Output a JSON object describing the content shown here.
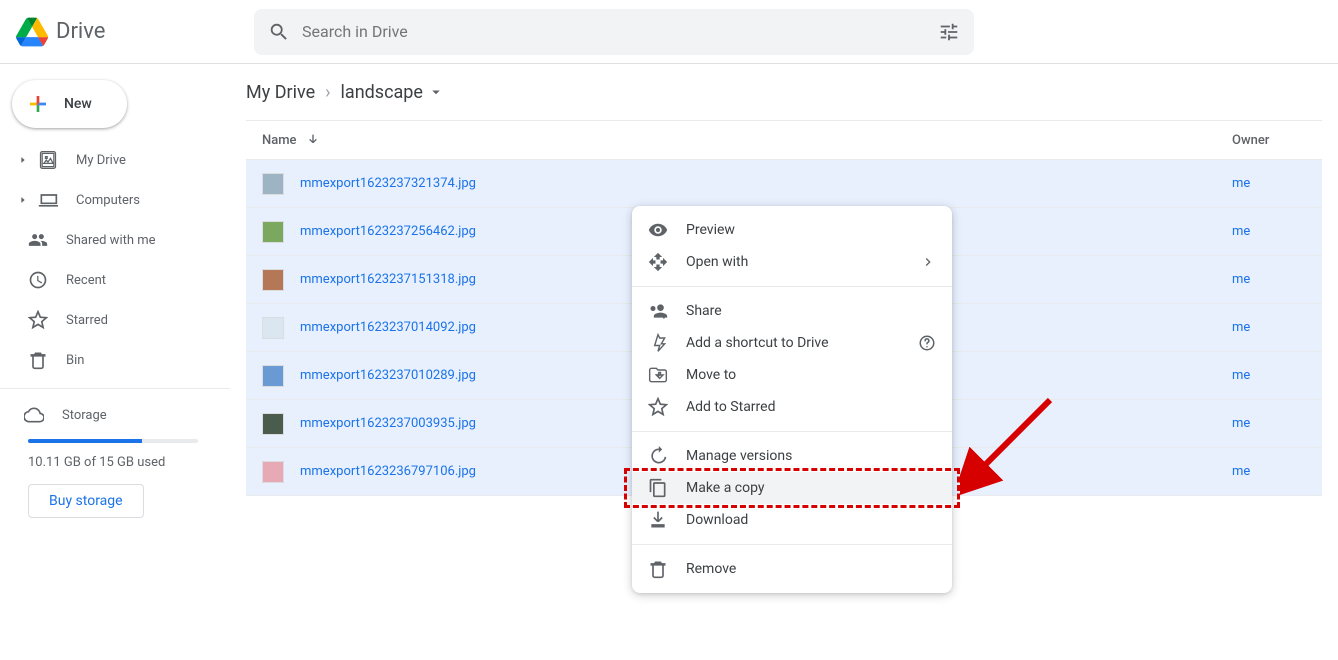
{
  "app": {
    "title": "Drive"
  },
  "search": {
    "placeholder": "Search in Drive"
  },
  "sidebar": {
    "new_label": "New",
    "items": [
      {
        "label": "My Drive"
      },
      {
        "label": "Computers"
      },
      {
        "label": "Shared with me"
      },
      {
        "label": "Recent"
      },
      {
        "label": "Starred"
      },
      {
        "label": "Bin"
      }
    ],
    "storage": {
      "label": "Storage",
      "used_text": "10.11 GB of 15 GB used",
      "buy_label": "Buy storage"
    }
  },
  "breadcrumb": {
    "root": "My Drive",
    "current": "landscape"
  },
  "table": {
    "headers": {
      "name": "Name",
      "owner": "Owner"
    },
    "rows": [
      {
        "name": "mmexport1623237321374.jpg",
        "owner": "me"
      },
      {
        "name": "mmexport1623237256462.jpg",
        "owner": "me"
      },
      {
        "name": "mmexport1623237151318.jpg",
        "owner": "me"
      },
      {
        "name": "mmexport1623237014092.jpg",
        "owner": "me"
      },
      {
        "name": "mmexport1623237010289.jpg",
        "owner": "me"
      },
      {
        "name": "mmexport1623237003935.jpg",
        "owner": "me"
      },
      {
        "name": "mmexport1623236797106.jpg",
        "owner": "me"
      }
    ]
  },
  "context_menu": {
    "preview": "Preview",
    "open_with": "Open with",
    "share": "Share",
    "add_shortcut": "Add a shortcut to Drive",
    "move_to": "Move to",
    "add_to_starred": "Add to Starred",
    "manage_versions": "Manage versions",
    "make_a_copy": "Make a copy",
    "download": "Download",
    "remove": "Remove"
  },
  "thumb_colors": [
    "#9cb4c4",
    "#7aa85f",
    "#b57857",
    "#dbe7f0",
    "#6a9ad4",
    "#4a5c4e",
    "#e7a9b5"
  ]
}
